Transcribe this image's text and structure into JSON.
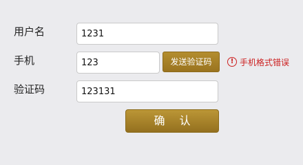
{
  "form": {
    "username": {
      "label": "用户名",
      "value": "1231"
    },
    "phone": {
      "label": "手机",
      "value": "123",
      "send_code_label": "发送验证码",
      "error_text": "手机格式错误",
      "error_icon": "!"
    },
    "code": {
      "label": "验证码",
      "value": "123131"
    },
    "confirm_label": "确 认"
  }
}
